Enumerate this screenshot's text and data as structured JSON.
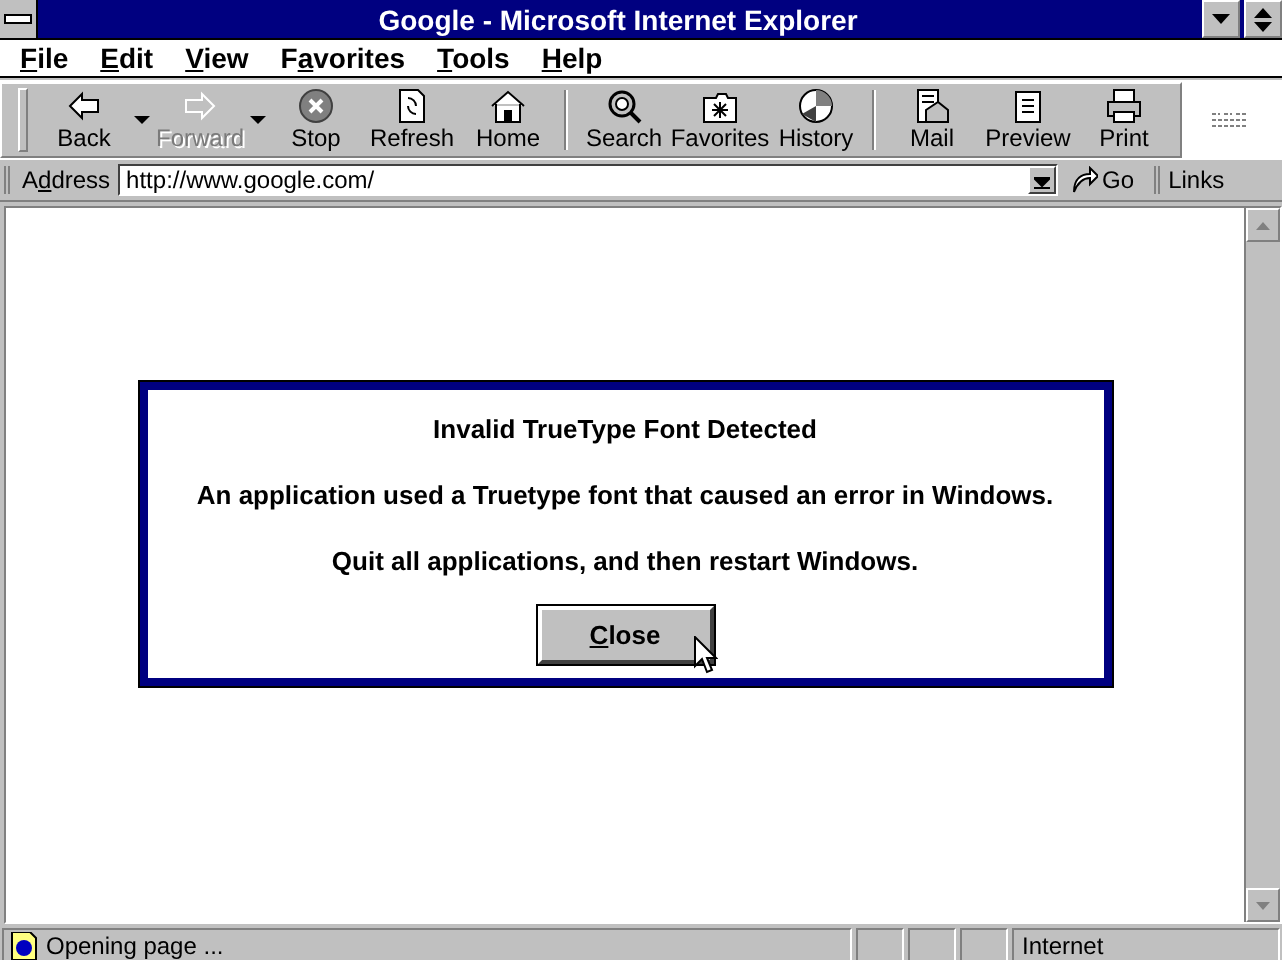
{
  "window": {
    "title": "Google - Microsoft Internet Explorer"
  },
  "menu": [
    {
      "key": "F",
      "after": "ile"
    },
    {
      "key": "E",
      "after": "dit"
    },
    {
      "key": "V",
      "after": "iew"
    },
    {
      "before": "F",
      "key": "a",
      "after": "vorites"
    },
    {
      "key": "T",
      "after": "ools"
    },
    {
      "key": "H",
      "after": "elp"
    }
  ],
  "toolbar": [
    {
      "label": "Back",
      "disabled": false,
      "dropdown": true,
      "group_start": false
    },
    {
      "label": "Forward",
      "disabled": true,
      "dropdown": true,
      "group_start": false
    },
    {
      "label": "Stop",
      "disabled": false,
      "dropdown": false,
      "group_start": false
    },
    {
      "label": "Refresh",
      "disabled": false,
      "dropdown": false,
      "group_start": false
    },
    {
      "label": "Home",
      "disabled": false,
      "dropdown": false,
      "group_start": false
    },
    {
      "label": "Search",
      "disabled": false,
      "dropdown": false,
      "group_start": true
    },
    {
      "label": "Favorites",
      "disabled": false,
      "dropdown": false,
      "group_start": false
    },
    {
      "label": "History",
      "disabled": false,
      "dropdown": false,
      "group_start": false
    },
    {
      "label": "Mail",
      "disabled": false,
      "dropdown": false,
      "group_start": true
    },
    {
      "label": "Preview",
      "disabled": false,
      "dropdown": false,
      "group_start": false
    },
    {
      "label": "Print",
      "disabled": false,
      "dropdown": false,
      "group_start": false
    }
  ],
  "address_bar": {
    "label_before": "A",
    "label_key": "d",
    "label_after": "dress",
    "value": "http://www.google.com/",
    "go": "Go",
    "links": "Links"
  },
  "dialog": {
    "title": "Invalid TrueType Font Detected",
    "message": "An application used a Truetype font that caused an error in Windows.",
    "instruction": "Quit all applications, and then restart Windows.",
    "button": {
      "key": "C",
      "after": "lose"
    }
  },
  "status_bar": {
    "text": "Opening page ...",
    "zone": "Internet"
  }
}
